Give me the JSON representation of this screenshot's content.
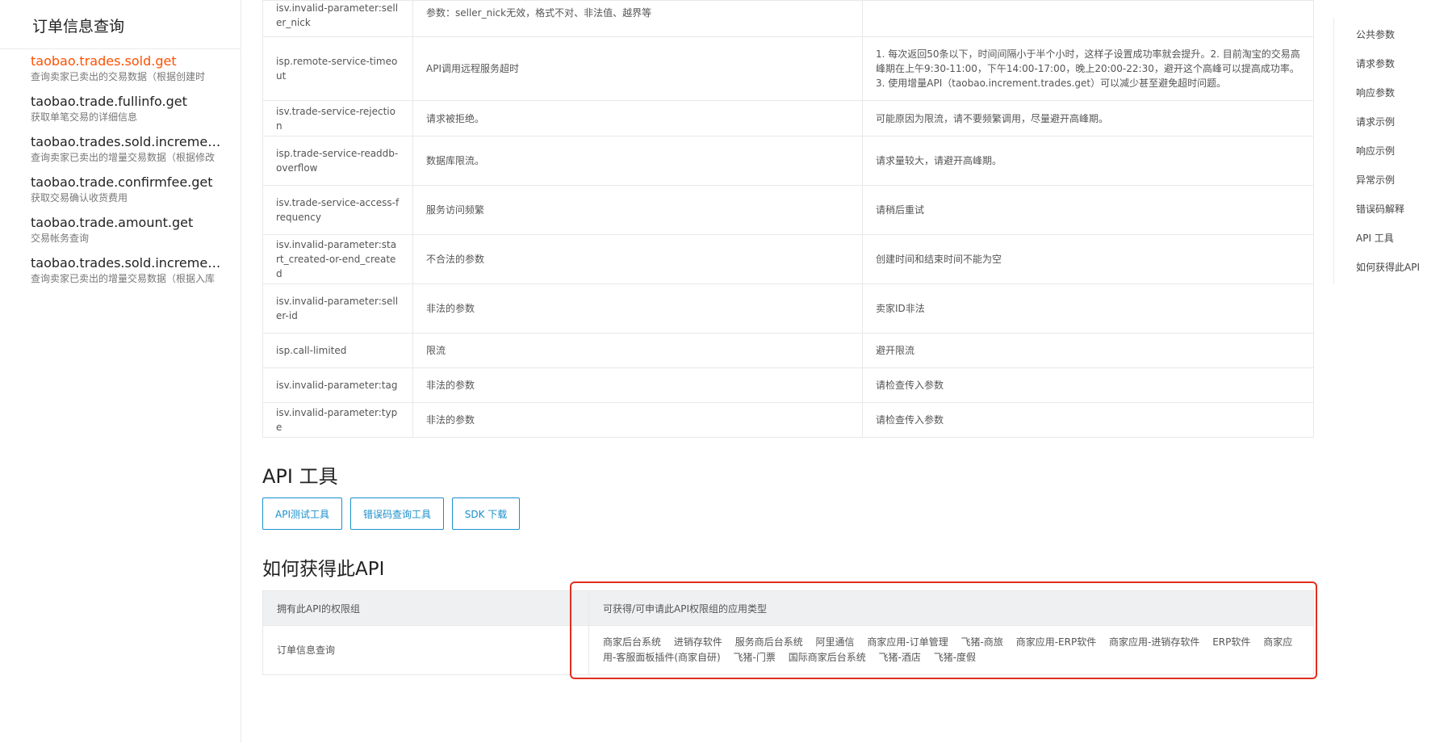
{
  "sidebar": {
    "title": "订单信息查询",
    "items": [
      {
        "name": "taobao.trades.sold.get",
        "desc": "查询卖家已卖出的交易数据（根据创建时",
        "active": true
      },
      {
        "name": "taobao.trade.fullinfo.get",
        "desc": "获取单笔交易的详细信息"
      },
      {
        "name": "taobao.trades.sold.increment.get",
        "desc": "查询卖家已卖出的增量交易数据（根据修改"
      },
      {
        "name": "taobao.trade.confirmfee.get",
        "desc": "获取交易确认收货费用"
      },
      {
        "name": "taobao.trade.amount.get",
        "desc": "交易帐务查询"
      },
      {
        "name": "taobao.trades.sold.incrementv.get",
        "desc": "查询卖家已卖出的增量交易数据（根据入库"
      }
    ]
  },
  "error_table": {
    "rows": [
      {
        "code": "isv.invalid-parameter:seller_nick",
        "msg": "参数：seller_nick无效，格式不对、非法值、越界等",
        "solution": ""
      },
      {
        "code": "isp.remote-service-timeout",
        "msg": "API调用远程服务超时",
        "solution": "1. 每次返回50条以下，时间间隔小于半个小时，这样子设置成功率就会提升。2. 目前淘宝的交易高峰期在上午9:30-11:00，下午14:00-17:00，晚上20:00-22:30，避开这个高峰可以提高成功率。3. 使用增量API（taobao.increment.trades.get）可以减少甚至避免超时问题。"
      },
      {
        "code": "isv.trade-service-rejection",
        "msg": "请求被拒绝。",
        "solution": "可能原因为限流，请不要频繁调用，尽量避开高峰期。"
      },
      {
        "code": "isp.trade-service-readdb-overflow",
        "msg": "数据库限流。",
        "solution": "请求量较大，请避开高峰期。"
      },
      {
        "code": "isv.trade-service-access-frequency",
        "msg": "服务访问频繁",
        "solution": "请稍后重试"
      },
      {
        "code": "isv.invalid-parameter:start_created-or-end_created",
        "msg": "不合法的参数",
        "solution": "创建时间和结束时间不能为空"
      },
      {
        "code": "isv.invalid-parameter:seller-id",
        "msg": "非法的参数",
        "solution": "卖家ID非法"
      },
      {
        "code": "isp.call-limited",
        "msg": "限流",
        "solution": "避开限流"
      },
      {
        "code": "isv.invalid-parameter:tag",
        "msg": "非法的参数",
        "solution": "请检查传入参数"
      },
      {
        "code": "isv.invalid-parameter:type",
        "msg": "非法的参数",
        "solution": "请检查传入参数"
      }
    ]
  },
  "api_tools": {
    "title": "API 工具",
    "buttons": [
      "API测试工具",
      "错误码查询工具",
      "SDK 下载"
    ]
  },
  "howto": {
    "title": "如何获得此API",
    "col1_header": "拥有此API的权限组",
    "col2_header": "可获得/可申请此API权限组的应用类型",
    "group": "订单信息查询",
    "app_types": [
      "商家后台系统",
      "进销存软件",
      "服务商后台系统",
      "阿里通信",
      "商家应用-订单管理",
      "飞猪-商旅",
      "商家应用-ERP软件",
      "商家应用-进销存软件",
      "ERP软件",
      "商家应用-客服面板插件(商家自研)",
      "飞猪-门票",
      "国际商家后台系统",
      "飞猪-酒店",
      "飞猪-度假"
    ]
  },
  "right_nav": [
    "公共参数",
    "请求参数",
    "响应参数",
    "请求示例",
    "响应示例",
    "异常示例",
    "错误码解释",
    "API 工具",
    "如何获得此API"
  ],
  "colors": {
    "active": "#ff5000",
    "link": "#1a8fcc",
    "highlight": "#e02f1e"
  }
}
